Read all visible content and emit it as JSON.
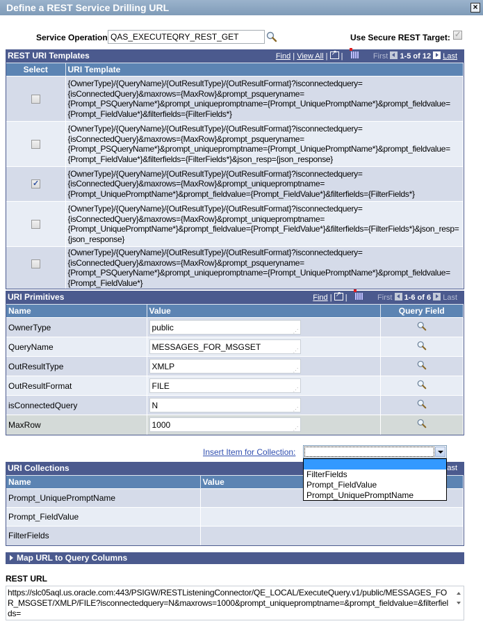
{
  "window": {
    "title": "Define a REST Service Drilling URL",
    "close_icon": "close-icon"
  },
  "service_operation": {
    "label": "Service Operation",
    "value": "QAS_EXECUTEQRY_REST_GET",
    "lookup_icon": "search-icon"
  },
  "secure_target": {
    "label": "Use Secure REST Target:",
    "checked": true,
    "disabled": true
  },
  "uri_templates": {
    "title": "REST URI Templates",
    "nav": {
      "find": "Find",
      "view_all": "View All",
      "sep": "|",
      "first": "First",
      "range": "1-5 of 12",
      "last": "Last"
    },
    "columns": [
      "Select",
      "URI Template"
    ],
    "rows": [
      {
        "checked": false,
        "template": "{OwnerType}/{QueryName}/{OutResultType}/{OutResultFormat}?isconnectedquery={isConnectedQuery}&maxrows={MaxRow}&prompt_psqueryname={Prompt_PSQueryName*}&prompt_uniquepromptname={Prompt_UniquePromptName*}&prompt_fieldvalue={Prompt_FieldValue*}&filterfields={FilterFields*}"
      },
      {
        "checked": false,
        "template": "{OwnerType}/{QueryName}/{OutResultType}/{OutResultFormat}?isconnectedquery={isConnectedQuery}&maxrows={MaxRow}&prompt_psqueryname={Prompt_PSQueryName*}&prompt_uniquepromptname={Prompt_UniquePromptName*}&prompt_fieldvalue={Prompt_FieldValue*}&filterfields={FilterFields*}&json_resp={json_response}"
      },
      {
        "checked": true,
        "template": "{OwnerType}/{QueryName}/{OutResultType}/{OutResultFormat}?isconnectedquery={isConnectedQuery}&maxrows={MaxRow}&prompt_uniquepromptname={Prompt_UniquePromptName*}&prompt_fieldvalue={Prompt_FieldValue*}&filterfields={FilterFields*}"
      },
      {
        "checked": false,
        "template": "{OwnerType}/{QueryName}/{OutResultType}/{OutResultFormat}?isconnectedquery={isConnectedQuery}&maxrows={MaxRow}&prompt_uniquepromptname={Prompt_UniquePromptName*}&prompt_fieldvalue={Prompt_FieldValue*}&filterfields={FilterFields*}&json_resp={json_response}"
      },
      {
        "checked": false,
        "template": "{OwnerType}/{QueryName}/{OutResultType}/{OutResultFormat}?isconnectedquery={isConnectedQuery}&maxrows={MaxRow}&prompt_psqueryname={Prompt_PSQueryName*}&prompt_uniquepromptname={Prompt_UniquePromptName*}&prompt_fieldvalue={Prompt_FieldValue*}"
      }
    ]
  },
  "uri_primitives": {
    "title": "URI Primitives",
    "nav": {
      "find": "Find",
      "sep": "|",
      "first": "First",
      "range": "1-6 of 6",
      "last": "Last"
    },
    "columns": [
      "Name",
      "Value",
      "Query Field"
    ],
    "rows": [
      {
        "name": "OwnerType",
        "value": "public"
      },
      {
        "name": "QueryName",
        "value": "MESSAGES_FOR_MSGSET"
      },
      {
        "name": "OutResultType",
        "value": "XMLP"
      },
      {
        "name": "OutResultFormat",
        "value": "FILE"
      },
      {
        "name": "isConnectedQuery",
        "value": "N"
      },
      {
        "name": "MaxRow",
        "value": "1000"
      }
    ]
  },
  "insert_collection": {
    "label": "Insert Item for Collection:",
    "selected": "",
    "options": [
      "",
      "FilterFields",
      "Prompt_FieldValue",
      "Prompt_UniquePromptName"
    ]
  },
  "uri_collections": {
    "title": "URI Collections",
    "nav_last": "Last",
    "columns": [
      "Name",
      "Value"
    ],
    "rows": [
      {
        "name": "Prompt_UniquePromptName",
        "value": ""
      },
      {
        "name": "Prompt_FieldValue",
        "value": ""
      },
      {
        "name": "FilterFields",
        "value": ""
      }
    ]
  },
  "map_section": {
    "label": "Map URL to Query Columns",
    "expanded": false
  },
  "rest_url": {
    "label": "REST URL",
    "value": "https://slc05aql.us.oracle.com:443/PSIGW/RESTListeningConnector/QE_LOCAL/ExecuteQuery.v1/public/MESSAGES_FOR_MSGSET/XMLP/FILE?isconnectedquery=N&maxrows=1000&prompt_uniquepromptname=&prompt_fieldvalue=&filterfields="
  }
}
